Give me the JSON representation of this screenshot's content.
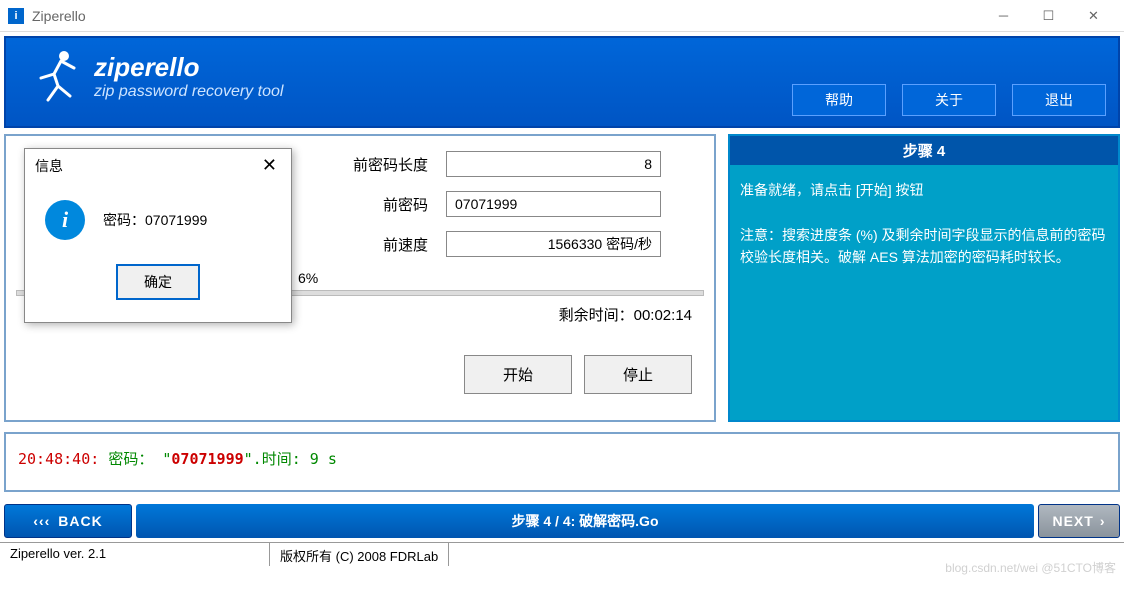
{
  "window": {
    "title": "Ziperello",
    "icon_letter": "i"
  },
  "header": {
    "brand": "ziperello",
    "tagline": "zip password recovery tool",
    "buttons": {
      "help": "帮助",
      "about": "关于",
      "exit": "退出"
    }
  },
  "fields": {
    "cur_len_label": "前密码长度",
    "cur_len_value": "8",
    "cur_pwd_label": "前密码",
    "cur_pwd_value": "07071999",
    "cur_speed_label": "前速度",
    "cur_speed_value": "1566330 密码/秒",
    "progress_pct": "6%",
    "remaining_label": "剩余时间：",
    "remaining_value": "00:02:14"
  },
  "actions": {
    "start": "开始",
    "stop": "停止"
  },
  "step_panel": {
    "title": "步骤 4",
    "line1": "准备就绪，请点击 [开始] 按钮",
    "line2": "注意：搜索进度条 (%) 及剩余时间字段显示的信息前的密码校验长度相关。破解 AES 算法加密的密码耗时较长。"
  },
  "log": {
    "time": "20:48:40:",
    "label": "密码：",
    "quote1": "\"",
    "password": "07071999",
    "quote2": "\".",
    "rest": "时间: 9 s"
  },
  "nav": {
    "back": "BACK",
    "status": "步骤 4 / 4: 破解密码.Go",
    "next": "NEXT"
  },
  "statusbar": {
    "version": "Ziperello ver. 2.1",
    "copyright": "版权所有 (C) 2008 FDRLab"
  },
  "modal": {
    "title": "信息",
    "message_prefix": "密码：",
    "message_value": "07071999",
    "ok": "确定"
  },
  "watermark": "blog.csdn.net/wei @51CTO博客"
}
